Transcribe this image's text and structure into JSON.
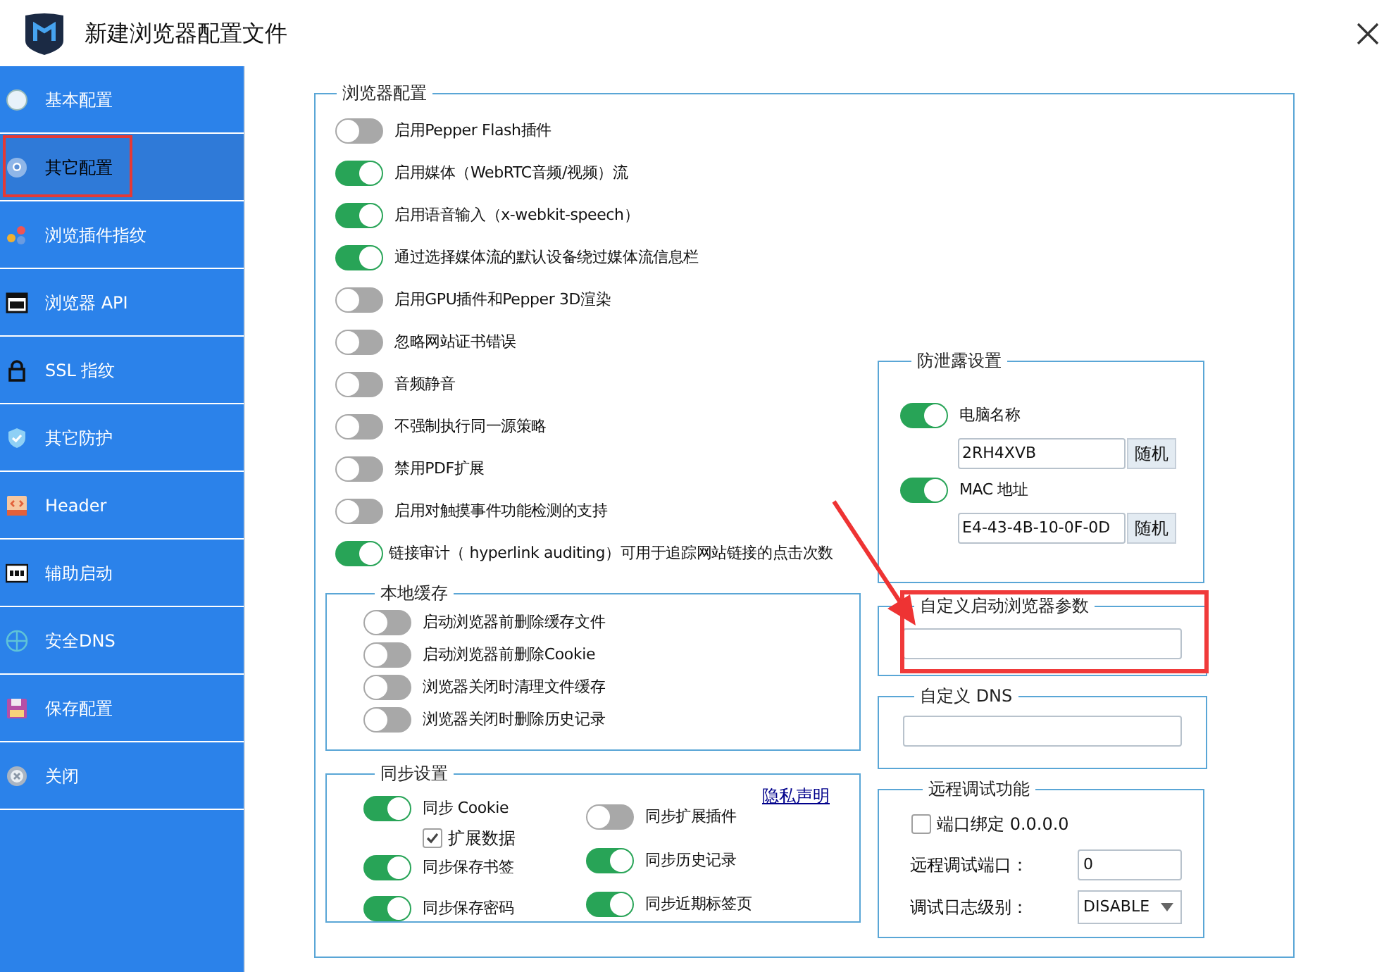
{
  "window": {
    "title": "新建浏览器配置文件"
  },
  "sidebar": {
    "items": [
      {
        "label": "基本配置",
        "selected": false
      },
      {
        "label": "其它配置",
        "selected": true
      },
      {
        "label": "浏览插件指纹",
        "selected": false
      },
      {
        "label": "浏览器 API",
        "selected": false
      },
      {
        "label": "SSL 指纹",
        "selected": false
      },
      {
        "label": "其它防护",
        "selected": false
      },
      {
        "label": "Header",
        "selected": false
      },
      {
        "label": "辅助启动",
        "selected": false
      },
      {
        "label": "安全DNS",
        "selected": false
      },
      {
        "label": "保存配置",
        "selected": false
      },
      {
        "label": "关闭",
        "selected": false
      }
    ]
  },
  "browser_config": {
    "title": "浏览器配置",
    "toggles": [
      {
        "label": "启用Pepper Flash插件",
        "on": false
      },
      {
        "label": "启用媒体（WebRTC音频/视频）流",
        "on": true
      },
      {
        "label": "启用语音输入（x-webkit-speech）",
        "on": true
      },
      {
        "label": "通过选择媒体流的默认设备绕过媒体流信息栏",
        "on": true
      },
      {
        "label": "启用GPU插件和Pepper 3D渲染",
        "on": false
      },
      {
        "label": "忽略网站证书错误",
        "on": false
      },
      {
        "label": "音频静音",
        "on": false
      },
      {
        "label": "不强制执行同一源策略",
        "on": false
      },
      {
        "label": "禁用PDF扩展",
        "on": false
      },
      {
        "label": "启用对触摸事件功能检测的支持",
        "on": false
      },
      {
        "label": "链接审计（ hyperlink auditing）可用于追踪网站链接的点击次数",
        "on": true
      }
    ]
  },
  "local_cache": {
    "title": "本地缓存",
    "toggles": [
      {
        "label": "启动浏览器前删除缓存文件",
        "on": false
      },
      {
        "label": "启动浏览器前删除Cookie",
        "on": false
      },
      {
        "label": "浏览器关闭时清理文件缓存",
        "on": false
      },
      {
        "label": "浏览器关闭时删除历史记录",
        "on": false
      }
    ]
  },
  "sync": {
    "title": "同步设置",
    "privacy_link": "隐私声明",
    "left": [
      {
        "kind": "toggle",
        "label": "同步 Cookie",
        "on": true
      },
      {
        "kind": "checkbox",
        "label": "扩展数据",
        "checked": true
      },
      {
        "kind": "toggle",
        "label": "同步保存书签",
        "on": true
      },
      {
        "kind": "toggle",
        "label": "同步保存密码",
        "on": true
      }
    ],
    "right": [
      {
        "kind": "toggle",
        "label": "同步扩展插件",
        "on": false
      },
      {
        "kind": "toggle",
        "label": "同步历史记录",
        "on": true
      },
      {
        "kind": "toggle",
        "label": "同步近期标签页",
        "on": true
      }
    ]
  },
  "leak_protection": {
    "title": "防泄露设置",
    "items": [
      {
        "label": "电脑名称",
        "on": true,
        "value": "2RH4XVB",
        "button": "随机"
      },
      {
        "label": "MAC 地址",
        "on": true,
        "value": "E4-43-4B-10-0F-0D",
        "button": "随机"
      }
    ]
  },
  "custom_args": {
    "title": "自定义启动浏览器参数"
  },
  "custom_dns": {
    "title": "自定义 DNS"
  },
  "remote_debug": {
    "title": "远程调试功能",
    "port_bind": {
      "label": "端口绑定 0.0.0.0",
      "checked": false
    },
    "port": {
      "label": "远程调试端口：",
      "value": "0"
    },
    "log_level": {
      "label": "调试日志级别：",
      "value": "DISABLE"
    }
  }
}
